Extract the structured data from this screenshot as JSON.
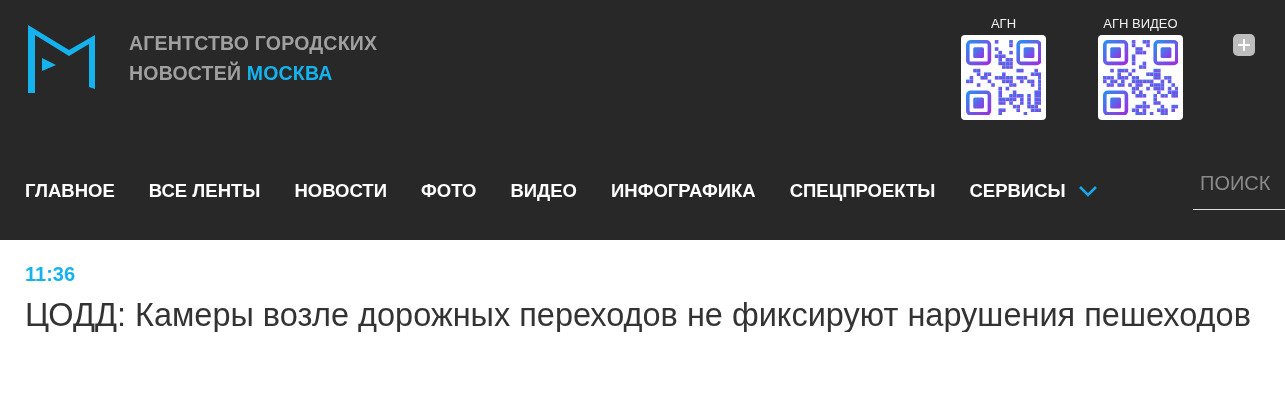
{
  "logo": {
    "lines": [
      "АГЕНТСТВО ГОРОДСКИХ",
      "НОВОСТЕЙ"
    ],
    "accent": "МОСКВА"
  },
  "qr_codes": [
    {
      "label": "АГН"
    },
    {
      "label": "АГН ВИДЕО"
    }
  ],
  "nav": {
    "items": [
      {
        "label": "ГЛАВНОЕ",
        "has_dropdown": false
      },
      {
        "label": "ВСЕ ЛЕНТЫ",
        "has_dropdown": false
      },
      {
        "label": "НОВОСТИ",
        "has_dropdown": false
      },
      {
        "label": "ФОТО",
        "has_dropdown": false
      },
      {
        "label": "ВИДЕО",
        "has_dropdown": false
      },
      {
        "label": "ИНФОГРАФИКА",
        "has_dropdown": false
      },
      {
        "label": "СПЕЦПРОЕКТЫ",
        "has_dropdown": false
      },
      {
        "label": "СЕРВИСЫ",
        "has_dropdown": true
      }
    ],
    "search": {
      "placeholder": "ПОИСК"
    }
  },
  "article": {
    "time": "11:36",
    "headline": "ЦОДД: Камеры возле дорожных переходов не фиксируют нарушения пешеходов"
  }
}
